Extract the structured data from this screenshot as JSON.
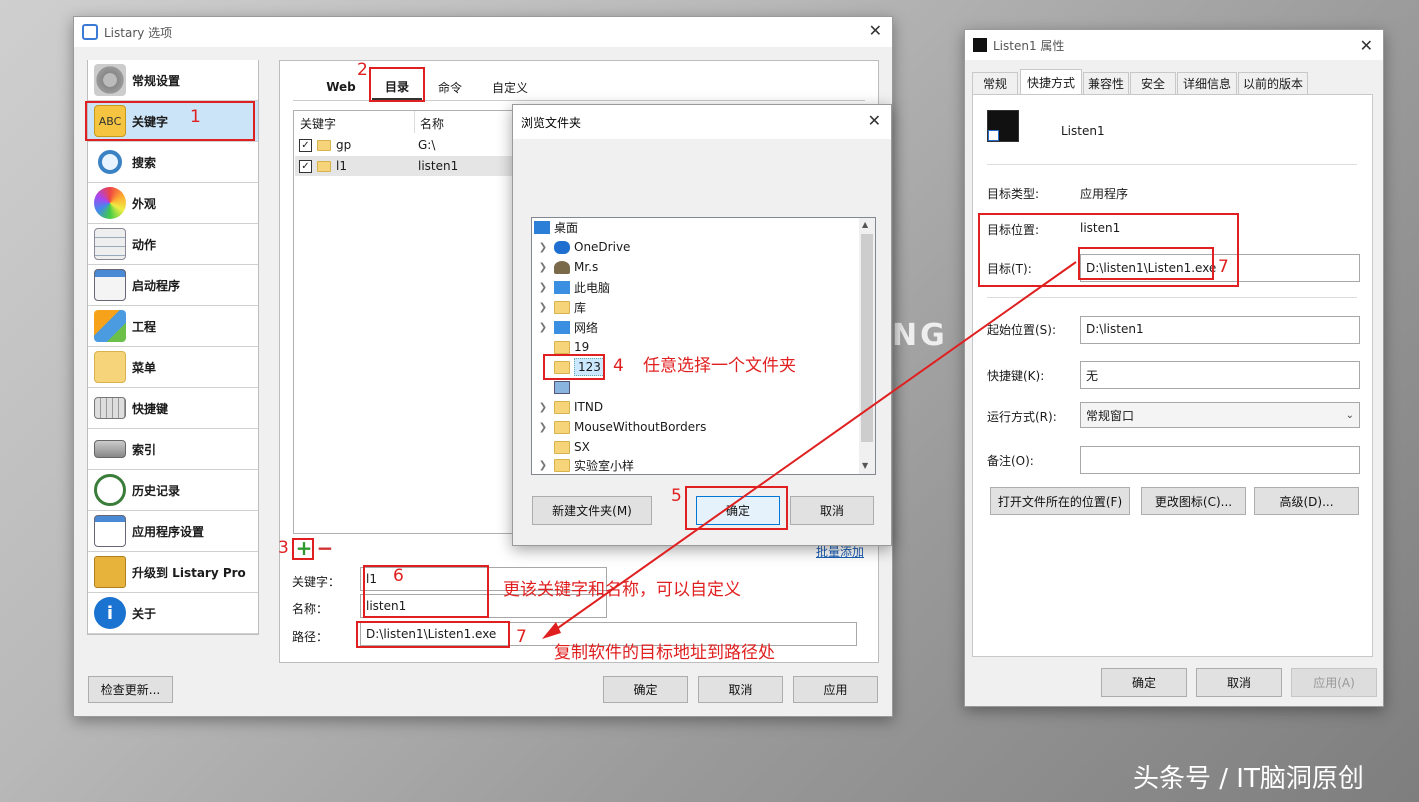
{
  "listary": {
    "title": "Listary 选项",
    "nav": [
      "常规设置",
      "关键字",
      "搜索",
      "外观",
      "动作",
      "启动程序",
      "工程",
      "菜单",
      "快捷键",
      "索引",
      "历史记录",
      "应用程序设置",
      "升级到 Listary Pro",
      "关于"
    ],
    "tabs": [
      "Web",
      "目录",
      "命令",
      "自定义"
    ],
    "table": {
      "headers": [
        "关键字",
        "名称"
      ],
      "rows": [
        {
          "key": "gp",
          "name": "G:\\"
        },
        {
          "key": "l1",
          "name": "listen1"
        }
      ]
    },
    "batch_add": "批量添加",
    "form": {
      "keyword_label": "关键字：",
      "keyword_value": "l1",
      "name_label": "名称：",
      "name_value": "listen1",
      "path_label": "路径：",
      "path_value": "D:\\listen1\\Listen1.exe"
    },
    "check_update": "检查更新...",
    "ok": "确定",
    "cancel": "取消",
    "apply": "应用"
  },
  "browse": {
    "title": "浏览文件夹",
    "tree": [
      "桌面",
      "OneDrive",
      "Mr.s",
      "此电脑",
      "库",
      "网络",
      "19",
      "123",
      "",
      "ITND",
      "MouseWithoutBorders",
      "SX",
      "实验室小样"
    ],
    "new_folder": "新建文件夹(M)",
    "ok": "确定",
    "cancel": "取消"
  },
  "props": {
    "title": "Listen1 属性",
    "tabs": [
      "常规",
      "快捷方式",
      "兼容性",
      "安全",
      "详细信息",
      "以前的版本"
    ],
    "app_name": "Listen1",
    "target_type_label": "目标类型:",
    "target_type": "应用程序",
    "target_loc_label": "目标位置:",
    "target_loc": "listen1",
    "target_label": "目标(T):",
    "target": "D:\\listen1\\Listen1.exe",
    "start_label": "起始位置(S):",
    "start": "D:\\listen1",
    "hotkey_label": "快捷键(K):",
    "hotkey": "无",
    "run_label": "运行方式(R):",
    "run": "常规窗口",
    "comment_label": "备注(O):",
    "comment": "",
    "open_loc": "打开文件所在的位置(F)",
    "change_icon": "更改图标(C)...",
    "advanced": "高级(D)...",
    "ok": "确定",
    "cancel": "取消",
    "apply": "应用(A)"
  },
  "annotations": {
    "n1": "1",
    "n2": "2",
    "n3": "3",
    "n4": "4",
    "n5": "5",
    "n6": "6",
    "n7a": "7",
    "n7b": "7",
    "t4": "任意选择一个文件夹",
    "t6": "更该关键字和名称，可以自定义",
    "t7": "复制软件的目标地址到路径处"
  },
  "watermark": "头条号 / IT脑洞原创",
  "bg_text": "NG"
}
